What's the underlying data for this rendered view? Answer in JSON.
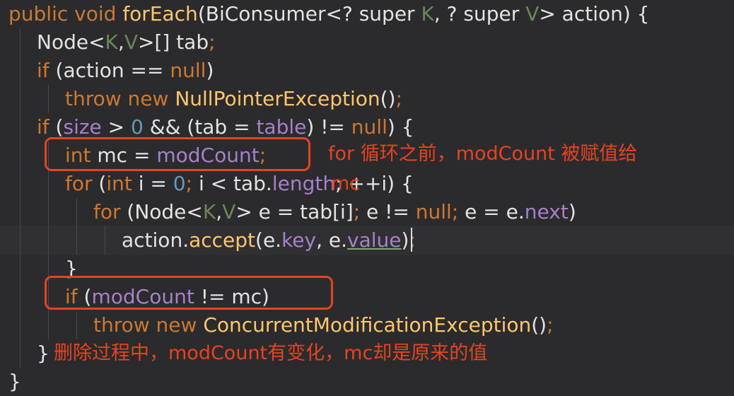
{
  "code": {
    "l1": {
      "t1": "public void ",
      "t2": "forEach",
      "t3": "(BiConsumer<? super ",
      "t4": "K",
      "t5": ", ? super ",
      "t6": "V",
      "t7": "> action) {"
    },
    "l2": {
      "t1": "Node<",
      "t2": "K",
      "t3": ",",
      "t4": "V",
      "t5": ">[] tab",
      "t6": ";"
    },
    "l3": {
      "t1": "if ",
      "t2": "(action == ",
      "t3": "null",
      "t4": ")"
    },
    "l4": {
      "t1": "throw new ",
      "t2": "NullPointerException",
      "t3": "()",
      "t4": ";"
    },
    "l5": {
      "t1": "if ",
      "t2": "(",
      "t3": "size",
      "t4": " > ",
      "t5": "0",
      "t6": " && (tab = ",
      "t7": "table",
      "t8": ") != ",
      "t9": "null",
      "t10": ") {"
    },
    "l6": {
      "t1": "int ",
      "t2": "mc = ",
      "t3": "modCount",
      "t4": ";"
    },
    "l7": {
      "t1": "for ",
      "t2": "(",
      "t3": "int ",
      "t4": "i = ",
      "t5": "0",
      "t6": "; ",
      "t7": "i < tab.",
      "t8": "length",
      "t9": "; ++i) {"
    },
    "l8": {
      "t1": "for ",
      "t2": "(Node<",
      "t3": "K",
      "t4": ",",
      "t5": "V",
      "t6": "> e = tab[i]",
      "t7": "; ",
      "t8": "e != ",
      "t9": "null",
      "t10": "; ",
      "t11": "e = e.",
      "t12": "next",
      "t13": ")"
    },
    "l9": {
      "t1": "action.",
      "t2": "accept",
      "t3": "(e.",
      "t4": "key",
      "t5": ", e.",
      "t6": "value",
      "t7": ")",
      "t8": ";"
    },
    "l10": {
      "t1": "}"
    },
    "l11": {
      "t1": "if ",
      "t2": "(",
      "t3": "modCount",
      "t4": " != mc)"
    },
    "l12": {
      "t1": "throw new ",
      "t2": "ConcurrentModificationException",
      "t3": "()",
      "t4": ";"
    },
    "l13": {
      "t1": "}"
    },
    "l14": {
      "t1": "}"
    }
  },
  "annotations": {
    "note1_line1": "for 循环之前，modCount 被赋值给",
    "note1_line2": "mc",
    "note2": "删除过程中，modCount有变化，mc却是原来的值"
  },
  "colors": {
    "background": "#2b2b2d",
    "keyword": "#cc7832",
    "method": "#ffc66d",
    "field": "#a681c8",
    "number": "#6897bb",
    "annotation": "#e8421f"
  }
}
